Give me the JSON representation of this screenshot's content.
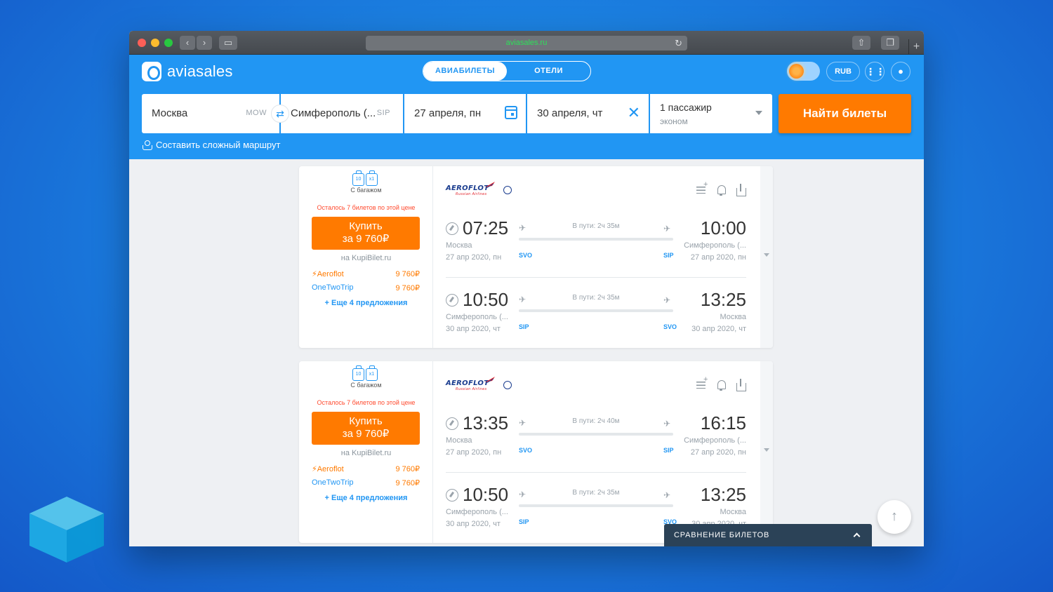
{
  "browser": {
    "address": "aviasales.ru"
  },
  "header": {
    "logo_text": "aviasales",
    "tabs": [
      {
        "label": "АВИАБИЛЕТЫ",
        "active": true
      },
      {
        "label": "ОТЕЛИ",
        "active": false
      }
    ],
    "currency": "RUB"
  },
  "search": {
    "from_city": "Москва",
    "from_code": "MOW",
    "to_city": "Симферополь (...",
    "to_code": "SIP",
    "date_depart": "27 апреля, пн",
    "date_return": "30 апреля, чт",
    "passengers": "1 пассажир",
    "class": "эконом",
    "find_button": "Найти билеты",
    "complex_route": "Составить сложный маршрут"
  },
  "results": [
    {
      "baggage_counts": [
        "10",
        "x1"
      ],
      "baggage_label": "С багажом",
      "tickets_left": "Осталось 7 билетов по этой цене",
      "buy_line1": "Купить",
      "buy_line2": "за 9 760₽",
      "seller": "на KupiBilet.ru",
      "offers": [
        {
          "agent": "⚡Aeroflot",
          "price": "9 760₽"
        },
        {
          "agent": "OneTwoTrip",
          "price": "9 760₽"
        }
      ],
      "more_offers": "+ Еще 4 предложения",
      "airline": "AEROFLOT",
      "airline_sub": "Russian Airlines",
      "segments": [
        {
          "dep_time": "07:25",
          "arr_time": "10:00",
          "duration": "В пути: 2ч 35м",
          "dep_city": "Москва",
          "arr_city": "Симферополь (...",
          "dep_date": "27 апр 2020, пн",
          "arr_date": "27 апр 2020, пн",
          "dep_code": "SVO",
          "arr_code": "SIP"
        },
        {
          "dep_time": "10:50",
          "arr_time": "13:25",
          "duration": "В пути: 2ч 35м",
          "dep_city": "Симферополь (...",
          "arr_city": "Москва",
          "dep_date": "30 апр 2020, чт",
          "arr_date": "30 апр 2020, чт",
          "dep_code": "SIP",
          "arr_code": "SVO"
        }
      ]
    },
    {
      "baggage_counts": [
        "10",
        "x1"
      ],
      "baggage_label": "С багажом",
      "tickets_left": "Осталось 7 билетов по этой цене",
      "buy_line1": "Купить",
      "buy_line2": "за 9 760₽",
      "seller": "на KupiBilet.ru",
      "offers": [
        {
          "agent": "⚡Aeroflot",
          "price": "9 760₽"
        },
        {
          "agent": "OneTwoTrip",
          "price": "9 760₽"
        }
      ],
      "more_offers": "+ Еще 4 предложения",
      "airline": "AEROFLOT",
      "airline_sub": "Russian Airlines",
      "segments": [
        {
          "dep_time": "13:35",
          "arr_time": "16:15",
          "duration": "В пути: 2ч 40м",
          "dep_city": "Москва",
          "arr_city": "Симферополь (...",
          "dep_date": "27 апр 2020, пн",
          "arr_date": "27 апр 2020, пн",
          "dep_code": "SVO",
          "arr_code": "SIP"
        },
        {
          "dep_time": "10:50",
          "arr_time": "13:25",
          "duration": "В пути: 2ч 35м",
          "dep_city": "Симферополь (...",
          "arr_city": "Москва",
          "dep_date": "30 апр 2020, чт",
          "arr_date": "30 апр 2020, чт",
          "dep_code": "SIP",
          "arr_code": "SVO"
        }
      ]
    }
  ],
  "compare_bar": "СРАВНЕНИЕ БИЛЕТОВ",
  "colors": {
    "brand_blue": "#2196f3",
    "accent_orange": "#ff7a00",
    "warning_red": "#ff4a2e"
  }
}
